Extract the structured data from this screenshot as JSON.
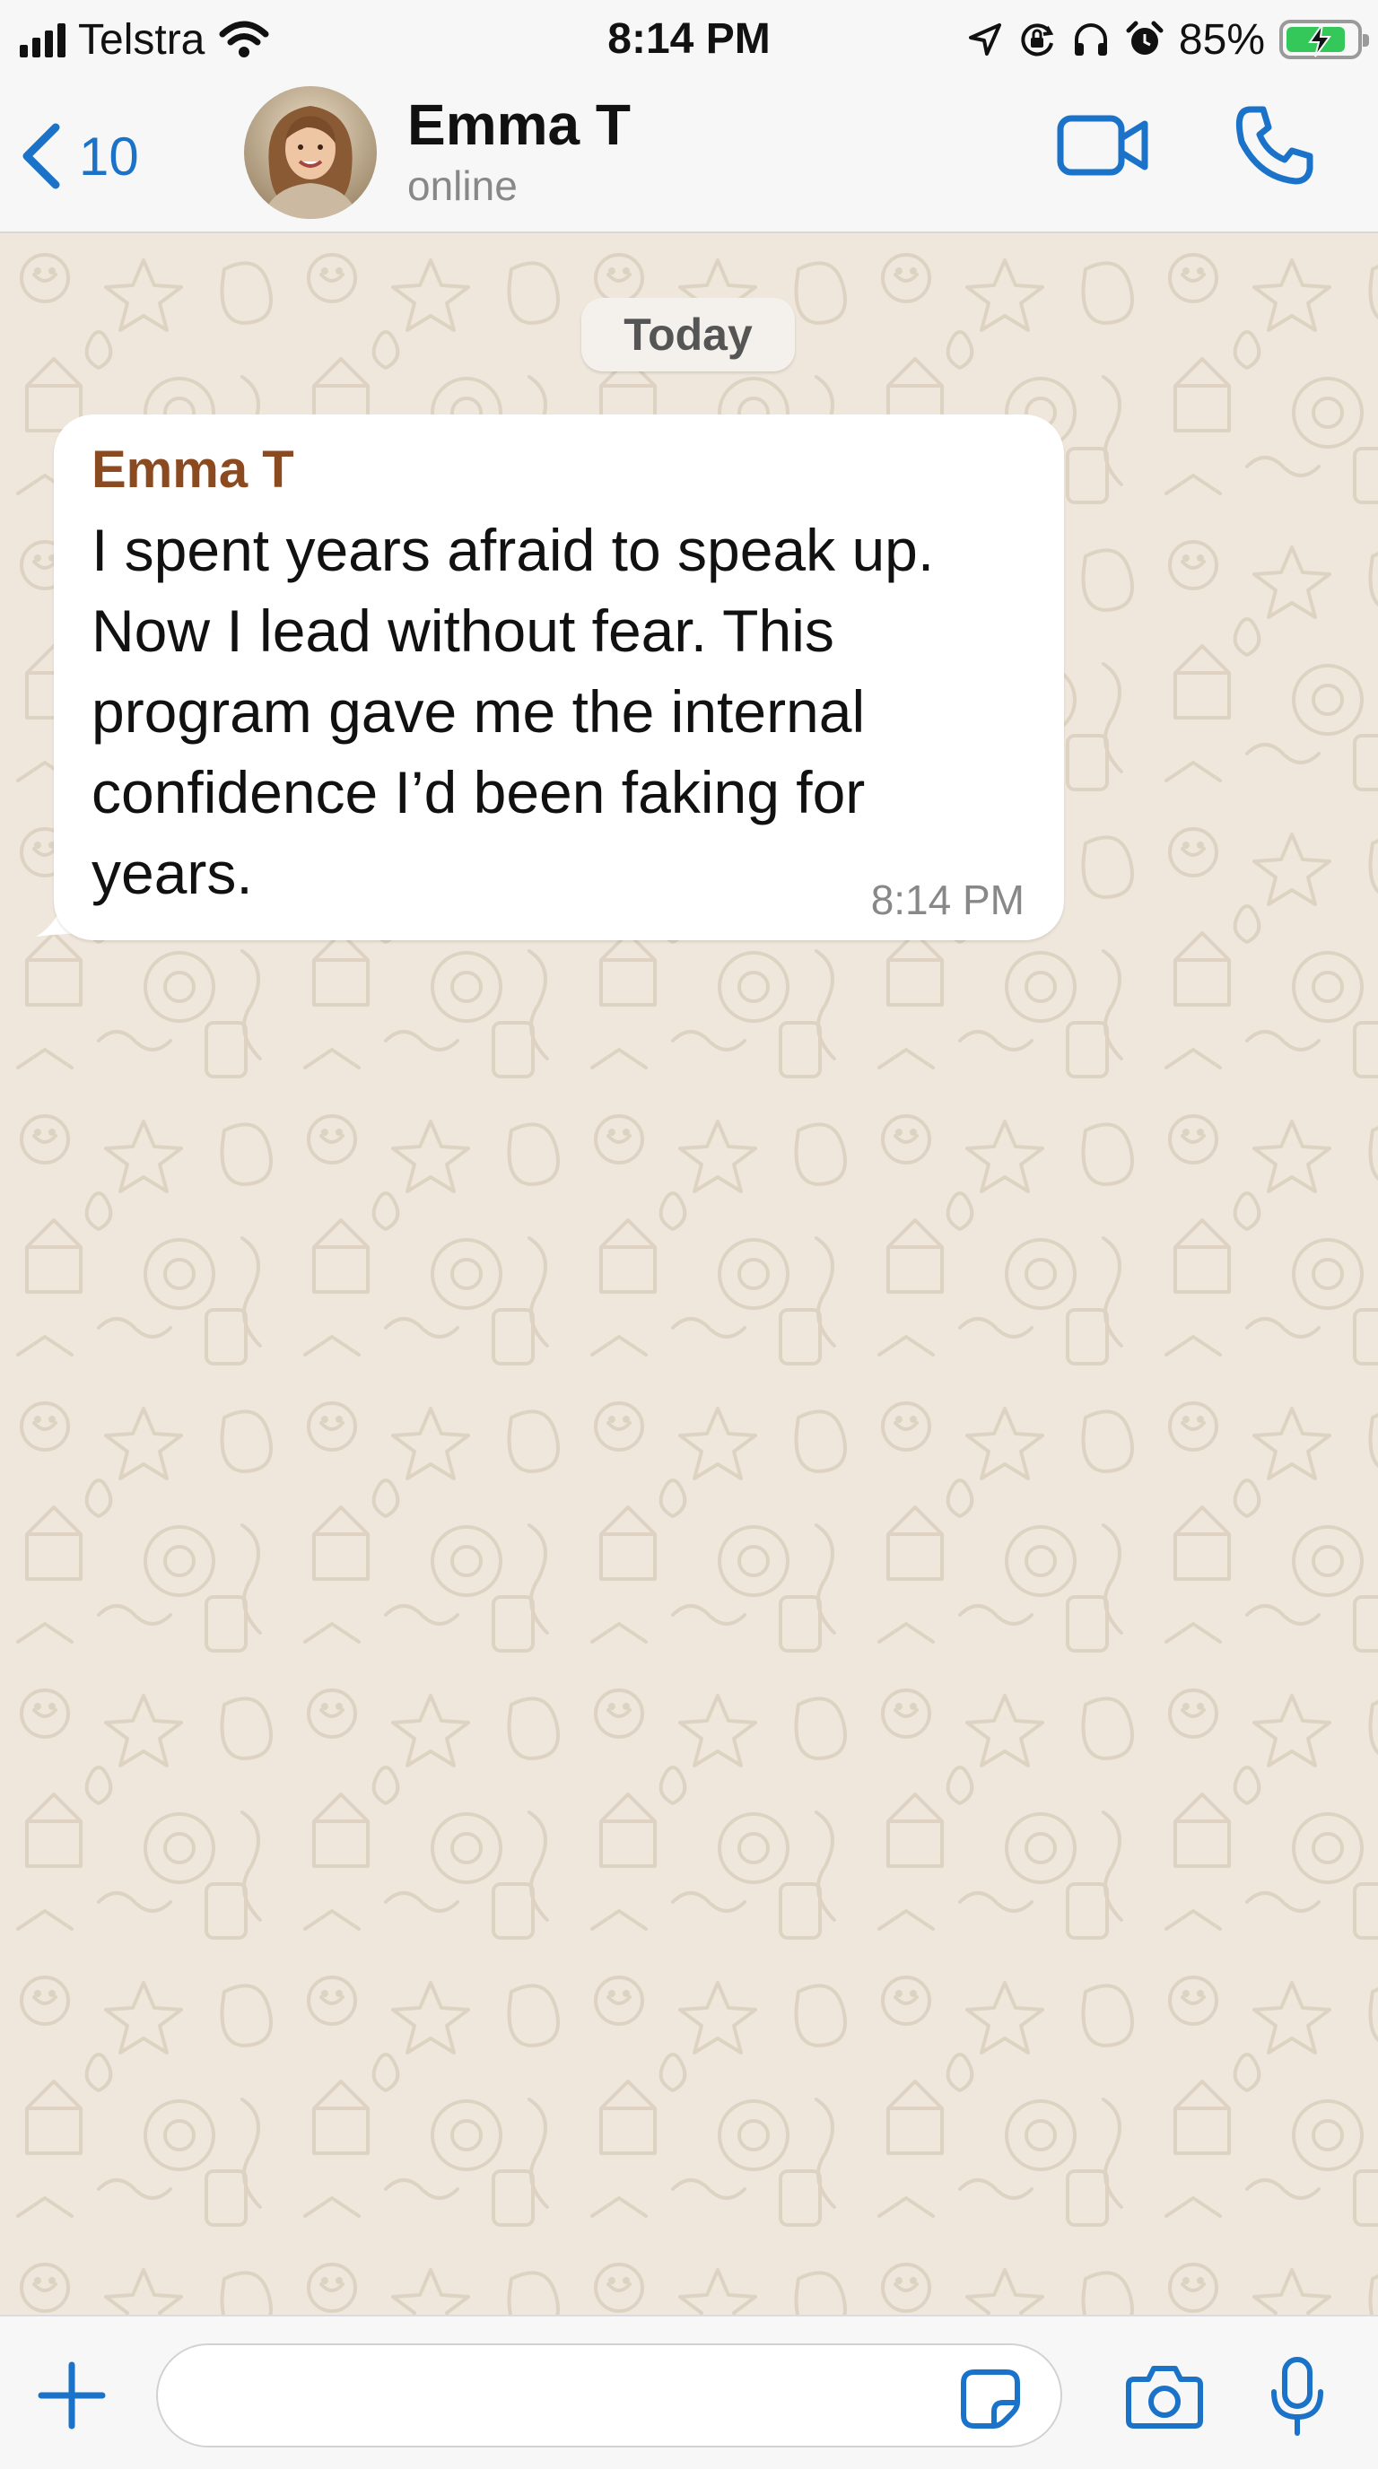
{
  "status_bar": {
    "carrier": "Telstra",
    "time": "8:14 PM",
    "battery_percent": "85%",
    "battery_level": 0.85,
    "icons": [
      "signal-icon",
      "wifi-icon",
      "location-arrow-icon",
      "orientation-lock-icon",
      "headphones-icon",
      "alarm-icon",
      "battery-charging-icon"
    ]
  },
  "header": {
    "back_count": "10",
    "contact_name": "Emma T",
    "contact_status": "online",
    "icons": [
      "chevron-left-icon",
      "video-camera-icon",
      "phone-icon"
    ]
  },
  "chat": {
    "date_label": "Today",
    "messages": [
      {
        "sender": "Emma T",
        "text": "I spent years afraid to speak up. Now I lead without fear. This program gave me the internal confidence I’d been faking for years.",
        "time": "8:14 PM",
        "direction": "incoming"
      }
    ]
  },
  "input_bar": {
    "message_value": "",
    "icons": [
      "plus-icon",
      "sticker-icon",
      "camera-icon",
      "microphone-icon"
    ]
  },
  "colors": {
    "accent": "#1a73c8",
    "sender_name": "#8b4a1f",
    "chat_background": "#efe7db",
    "bubble_incoming": "#ffffff",
    "battery_fill": "#34c759"
  }
}
